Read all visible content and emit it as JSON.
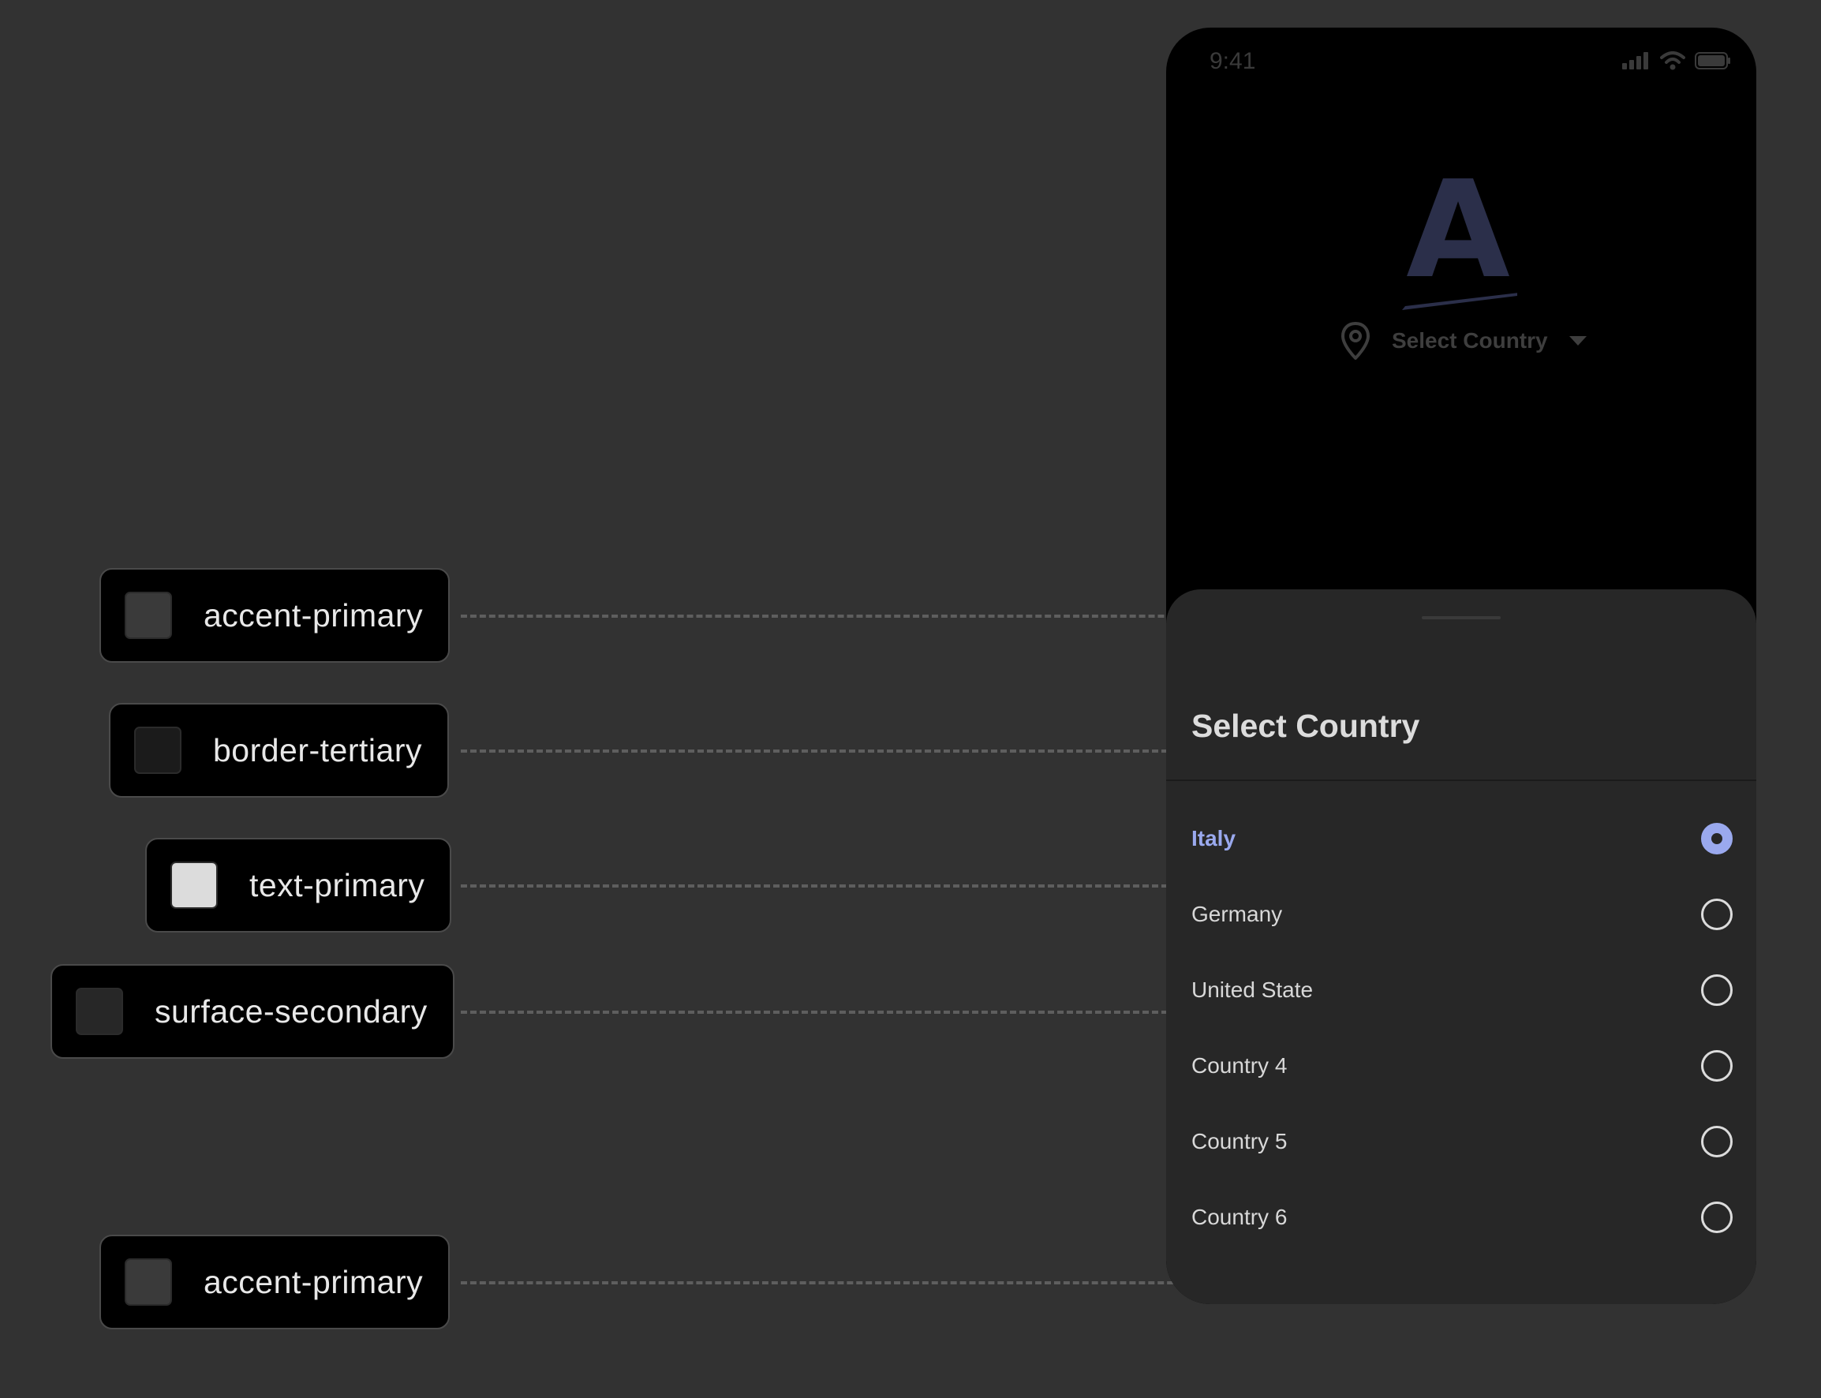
{
  "tokens": {
    "chip1": {
      "label": "accent-primary",
      "color": "#3a3a3a"
    },
    "chip2": {
      "label": "border-tertiary",
      "color": "#1b1b1b"
    },
    "chip3": {
      "label": "text-primary",
      "color": "#dcdcdc"
    },
    "chip4": {
      "label": "surface-secondary",
      "color": "#272727"
    },
    "chip5": {
      "label": "accent-primary",
      "color": "#3a3a3a"
    }
  },
  "status_bar": {
    "time": "9:41",
    "icons": [
      "signal-icon",
      "wifi-icon",
      "battery-icon"
    ]
  },
  "header": {
    "logo_letter": "A",
    "logo_color": "#2b2f4a",
    "location_icon": "map-pin-icon",
    "location_label": "Select Country",
    "dropdown_icon": "caret-down-icon"
  },
  "sheet": {
    "title": "Select Country",
    "selected_index": 0,
    "accent_color": "#9aa9ee",
    "options": [
      {
        "label": "Italy"
      },
      {
        "label": "Germany"
      },
      {
        "label": "United State"
      },
      {
        "label": "Country 4"
      },
      {
        "label": "Country 5"
      },
      {
        "label": "Country 6"
      }
    ]
  }
}
